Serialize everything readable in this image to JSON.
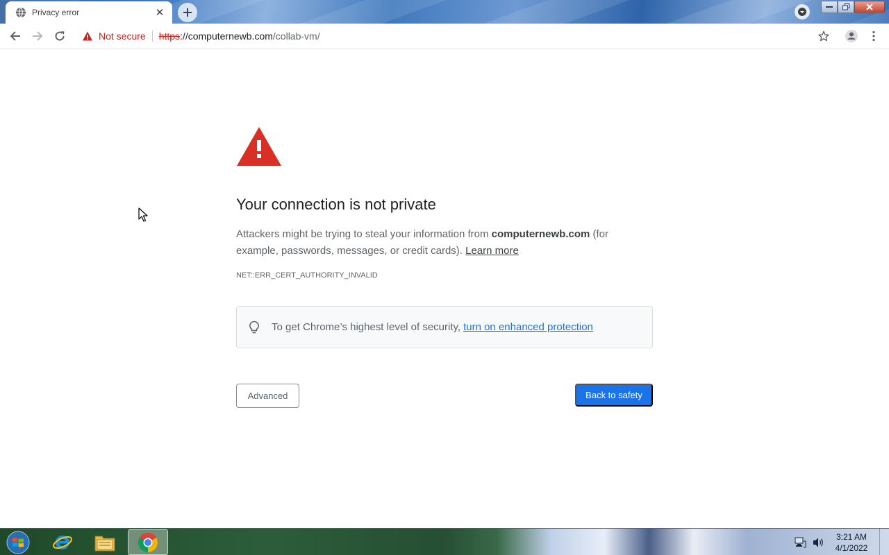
{
  "browser": {
    "tab": {
      "title": "Privacy error",
      "close_glyph": "✕"
    },
    "omnibox": {
      "security_label": "Not secure",
      "url_scheme": "https",
      "url_host": "://computernewb.com",
      "url_path": "/collab-vm/"
    }
  },
  "page": {
    "heading": "Your connection is not private",
    "message_before": "Attackers might be trying to steal your information from ",
    "message_domain": "computernewb.com",
    "message_after": " (for example, passwords, messages, or credit cards). ",
    "learn_more": "Learn more",
    "error_code": "NET::ERR_CERT_AUTHORITY_INVALID",
    "promo_text": "To get Chrome’s highest level of security,",
    "promo_link": "turn on enhanced protection",
    "advanced_button": "Advanced",
    "safety_button": "Back to safety"
  },
  "taskbar": {
    "clock_time": "3:21 AM",
    "clock_date": "4/1/2022"
  },
  "colors": {
    "accent_blue": "#1a73e8",
    "warning_red": "#d93025",
    "not_secure_red": "#c5221f"
  },
  "icons": [
    "globe-icon",
    "close-icon",
    "plus-icon",
    "back-arrow-icon",
    "forward-arrow-icon",
    "reload-icon",
    "warning-triangle-icon",
    "star-icon",
    "account-icon",
    "kebab-menu-icon",
    "lightbulb-icon",
    "windows-logo-icon",
    "internet-explorer-icon",
    "folder-icon",
    "chrome-icon",
    "network-icon",
    "volume-icon"
  ]
}
